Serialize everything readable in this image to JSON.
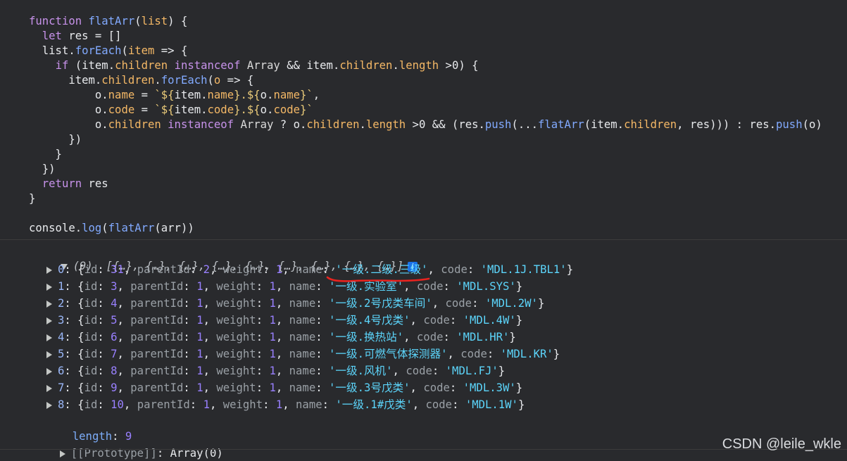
{
  "code": {
    "lines": [
      "function flatArr(list) {",
      "  let res = []",
      "  list.forEach(item => {",
      "    if (item.children instanceof Array && item.children.length >0) {",
      "      item.children.forEach(o => {",
      "          o.name = `${item.name}.${o.name}`,",
      "          o.code = `${item.code}.${o.code}`",
      "          o.children instanceof Array ? o.children.length >0 && (res.push(...flatArr(item.children, res))) : res.push(o)",
      "      })",
      "    }",
      "  })",
      "  return res",
      "}"
    ],
    "console_call": "console.log(flatArr(arr))"
  },
  "console": {
    "summary_count": "(9)",
    "summary_items": "[{…}, {…}, {…}, {…}, {…}, {…}, {…}, {…}, {…}]",
    "info_icon": "i",
    "items": [
      {
        "index": "0",
        "id": "31",
        "parentId": "2",
        "weight": "1",
        "name": "'一级.二级.三级'",
        "code": "'MDL.1J.TBL1'"
      },
      {
        "index": "1",
        "id": "3",
        "parentId": "1",
        "weight": "1",
        "name": "'一级.实验室'",
        "code": "'MDL.SYS'"
      },
      {
        "index": "2",
        "id": "4",
        "parentId": "1",
        "weight": "1",
        "name": "'一级.2号戊类车间'",
        "code": "'MDL.2W'"
      },
      {
        "index": "3",
        "id": "5",
        "parentId": "1",
        "weight": "1",
        "name": "'一级.4号戊类'",
        "code": "'MDL.4W'"
      },
      {
        "index": "4",
        "id": "6",
        "parentId": "1",
        "weight": "1",
        "name": "'一级.换热站'",
        "code": "'MDL.HR'"
      },
      {
        "index": "5",
        "id": "7",
        "parentId": "1",
        "weight": "1",
        "name": "'一级.可燃气体探测器'",
        "code": "'MDL.KR'"
      },
      {
        "index": "6",
        "id": "8",
        "parentId": "1",
        "weight": "1",
        "name": "'一级.风机'",
        "code": "'MDL.FJ'"
      },
      {
        "index": "7",
        "id": "9",
        "parentId": "1",
        "weight": "1",
        "name": "'一级.3号戊类'",
        "code": "'MDL.3W'"
      },
      {
        "index": "8",
        "id": "10",
        "parentId": "1",
        "weight": "1",
        "name": "'一级.1#戊类'",
        "code": "'MDL.1W'"
      }
    ],
    "length_key": "length",
    "length_value": "9",
    "prototype_key": "[[Prototype]]",
    "prototype_value": "Array(0)"
  },
  "watermark": "CSDN @leile_wkle",
  "colors": {
    "background": "#292a2d",
    "annotation_underline": "#e8231f"
  }
}
